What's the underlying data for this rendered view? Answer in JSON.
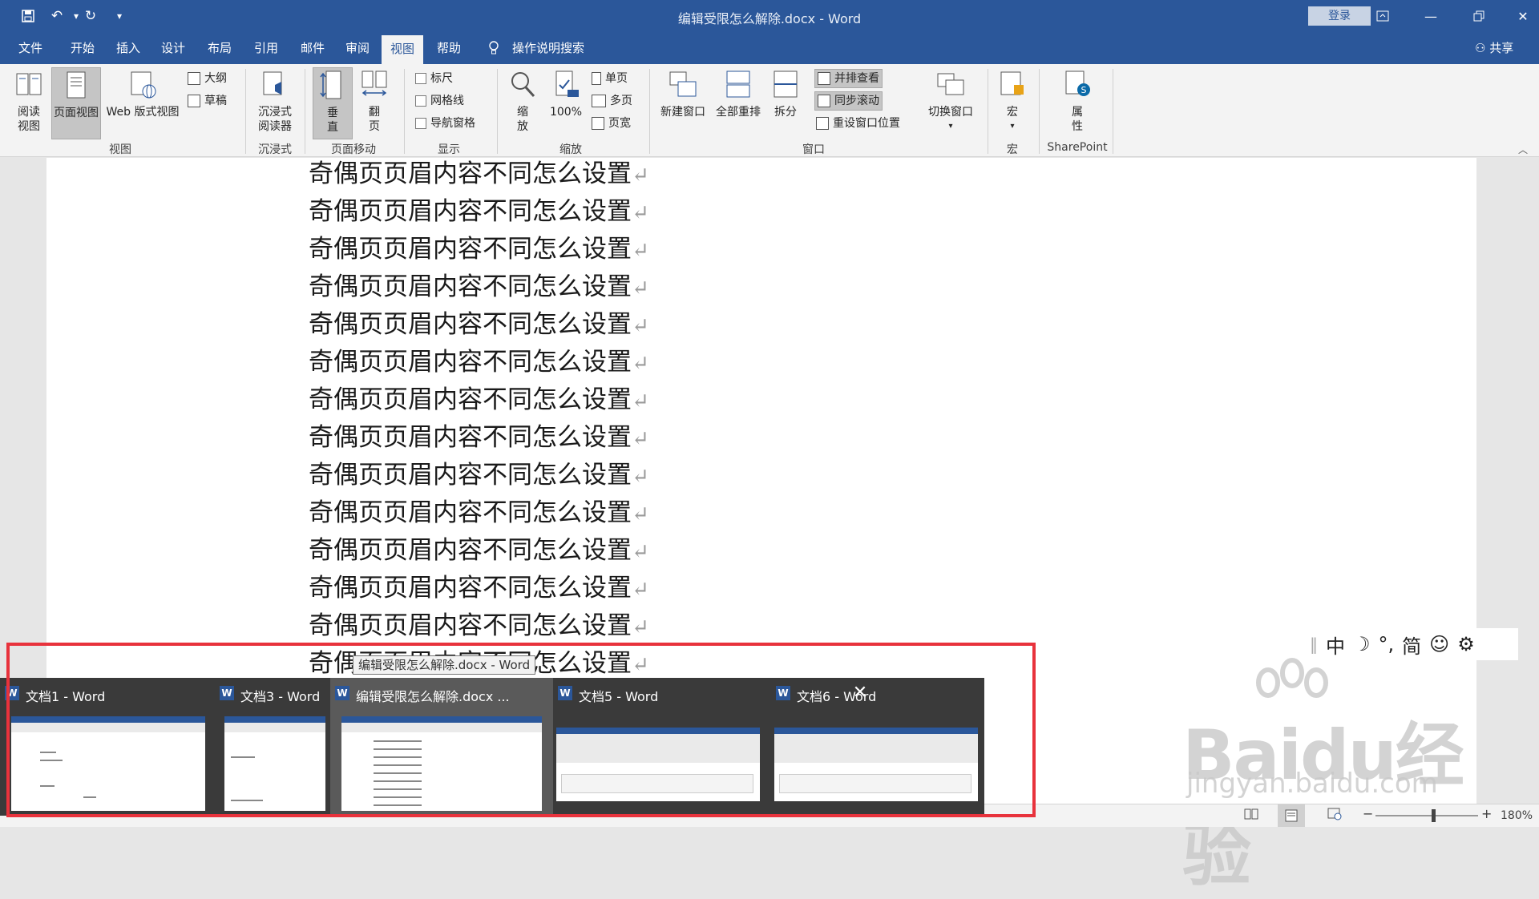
{
  "window": {
    "title": "编辑受限怎么解除.docx - Word",
    "login_label": "登录"
  },
  "tabs": [
    "文件",
    "开始",
    "插入",
    "设计",
    "布局",
    "引用",
    "邮件",
    "审阅",
    "视图",
    "帮助"
  ],
  "tab_active": "视图",
  "search_label": "操作说明搜索",
  "share_label": "共享",
  "ribbon": {
    "views": {
      "read": "阅读\n视图",
      "print": "页面视图",
      "web": "Web 版式视图",
      "outline": "大纲",
      "draft": "草稿",
      "group": "视图"
    },
    "immersive": {
      "reader": "沉浸式\n阅读器",
      "group": "沉浸式"
    },
    "movement": {
      "vertical": "垂\n直",
      "side": "翻\n页",
      "group": "页面移动"
    },
    "show": {
      "ruler": "标尺",
      "gridlines": "网格线",
      "nav": "导航窗格",
      "group": "显示"
    },
    "zoom": {
      "zoom": "缩\n放",
      "hundred": "100%",
      "one": "单页",
      "multi": "多页",
      "width": "页宽",
      "group": "缩放"
    },
    "window": {
      "new": "新建窗口",
      "arrange": "全部重排",
      "split": "拆分",
      "side_by_side": "并排查看",
      "sync": "同步滚动",
      "reset": "重设窗口位置",
      "switch": "切换窗口",
      "group": "窗口"
    },
    "macros": {
      "macro": "宏",
      "group": "宏"
    },
    "sharepoint": {
      "props": "属\n性",
      "group": "SharePoint"
    }
  },
  "document": {
    "line_text": "奇偶页页眉内容不同怎么设置",
    "para_mark": "↵"
  },
  "status": {
    "zoom": "180%"
  },
  "ime": [
    "中",
    "☽",
    "°,",
    "简",
    "☺",
    "⚙"
  ],
  "watermark": {
    "brand": "Baidu经验",
    "url": "jingyan.baidu.com"
  },
  "taskbar": {
    "tooltip": "编辑受限怎么解除.docx - Word",
    "items": [
      "文档1 - Word",
      "文档3 - Word",
      "编辑受限怎么解除.docx ...",
      "文档5 - Word",
      "文档6 - Word"
    ]
  }
}
